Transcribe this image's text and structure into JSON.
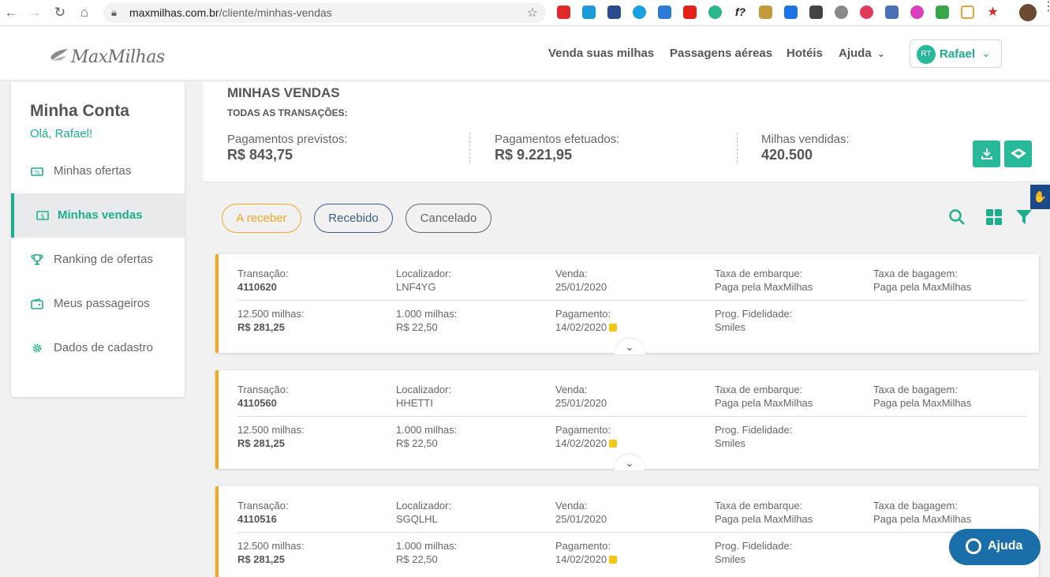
{
  "browser": {
    "url_domain": "maxmilhas.com.br",
    "url_path": "/cliente/minhas-vendas"
  },
  "header": {
    "brand": "MaxMilhas",
    "nav": [
      "Venda suas milhas",
      "Passagens aéreas",
      "Hotéis",
      "Ajuda"
    ],
    "user_initials": "RT",
    "user_name": "Rafael"
  },
  "sidebar": {
    "title": "Minha Conta",
    "greeting": "Olá, Rafael!",
    "items": [
      {
        "label": "Minhas ofertas",
        "icon": "ticket-icon"
      },
      {
        "label": "Minhas vendas",
        "icon": "money-icon",
        "active": true
      },
      {
        "label": "Ranking de ofertas",
        "icon": "trophy-icon"
      },
      {
        "label": "Meus passageiros",
        "icon": "wallet-icon"
      },
      {
        "label": "Dados de cadastro",
        "icon": "gear-icon"
      }
    ]
  },
  "summary": {
    "title": "MINHAS VENDAS",
    "subtitle": "TODAS AS TRANSAÇÕES:",
    "stats": [
      {
        "label": "Pagamentos previstos:",
        "value": "R$ 843,75"
      },
      {
        "label": "Pagamentos efetuados:",
        "value": "R$ 9.221,95"
      },
      {
        "label": "Milhas vendidas:",
        "value": "420.500"
      }
    ]
  },
  "filters": {
    "a_receber": "A receber",
    "recebido": "Recebido",
    "cancelado": "Cancelado"
  },
  "labels": {
    "transacao": "Transação:",
    "localizador": "Localizador:",
    "venda": "Venda:",
    "taxa_embarque": "Taxa de embarque:",
    "taxa_bagagem": "Taxa de bagagem:",
    "pagamento": "Pagamento:",
    "prog_fidelidade": "Prog. Fidelidade:"
  },
  "transactions": [
    {
      "id": "4110620",
      "localizador": "LNF4YG",
      "venda": "25/01/2020",
      "taxa_embarque": "Paga pela MaxMilhas",
      "taxa_bagagem": "Paga pela MaxMilhas",
      "milhas_label": "12.500 milhas:",
      "milhas_valor": "R$ 281,25",
      "extra_label": "1.000 milhas:",
      "extra_valor": "R$ 22,50",
      "pagamento": "14/02/2020",
      "programa": "Smiles"
    },
    {
      "id": "4110560",
      "localizador": "HHETTI",
      "venda": "25/01/2020",
      "taxa_embarque": "Paga pela MaxMilhas",
      "taxa_bagagem": "Paga pela MaxMilhas",
      "milhas_label": "12.500 milhas:",
      "milhas_valor": "R$ 281,25",
      "extra_label": "1.000 milhas:",
      "extra_valor": "R$ 22,50",
      "pagamento": "14/02/2020",
      "programa": "Smiles"
    },
    {
      "id": "4110516",
      "localizador": "SGQLHL",
      "venda": "25/01/2020",
      "taxa_embarque": "Paga pela MaxMilhas",
      "taxa_bagagem": "Paga pela MaxMilhas",
      "milhas_label": "12.500 milhas:",
      "milhas_valor": "R$ 281,25",
      "extra_label": "1.000 milhas:",
      "extra_valor": "R$ 22,50",
      "pagamento": "14/02/2020",
      "programa": "Smiles"
    }
  ],
  "help_button": "Ajuda",
  "colors": {
    "accent": "#1fae8d",
    "pending": "#f5a623",
    "help": "#1b6fa8"
  }
}
